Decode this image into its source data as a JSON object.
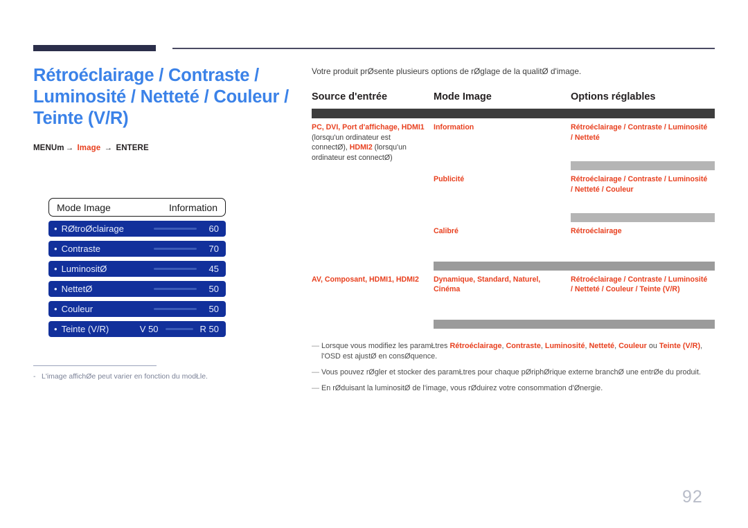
{
  "header": {
    "title": "Rétroéclairage / Contraste / Luminosité / Netteté / Couleur / Teinte (V/R)",
    "menu_path": {
      "menu_label": "MENU",
      "menu_glyph": "m",
      "arrow": "→",
      "middle_label": "Image",
      "enter_label": "ENTER",
      "enter_glyph": "E"
    }
  },
  "osd": {
    "head": {
      "left": "Mode Image",
      "right": "Information"
    },
    "rows": [
      {
        "bullet": "•",
        "label": "RØtroØclairage",
        "value": "60",
        "slider": true
      },
      {
        "bullet": "•",
        "label": "Contraste",
        "value": "70",
        "slider": true
      },
      {
        "bullet": "•",
        "label": "LuminositØ",
        "value": "45",
        "slider": true
      },
      {
        "bullet": "•",
        "label": "NettetØ",
        "value": "50",
        "slider": true
      },
      {
        "bullet": "•",
        "label": "Couleur",
        "value": "50",
        "slider": true
      },
      {
        "bullet": "•",
        "label": "Teinte (V/R)",
        "value": "R 50",
        "value_left": "V 50",
        "slider": true
      }
    ]
  },
  "left_footnote": {
    "dash": "-",
    "text": "L'image affichØe peut varier en fonction du modŁle."
  },
  "right": {
    "intro": "Votre produit prØsente plusieurs options de rØglage de la qualitØ d'image.",
    "table": {
      "headers": [
        "Source d'entrée",
        "Mode Image",
        "Options réglables"
      ],
      "groups": [
        {
          "source_parts": [
            {
              "text": "PC",
              "style": "red"
            },
            {
              "text": ", ",
              "style": "sep"
            },
            {
              "text": "DVI",
              "style": "red"
            },
            {
              "text": ", ",
              "style": "sep"
            },
            {
              "text": "Port d'affichage",
              "style": "red"
            },
            {
              "text": ", ",
              "style": "sep"
            },
            {
              "text": "HDMI1",
              "style": "red"
            },
            {
              "text": " (lorsqu'un ordinateur est connectØ), ",
              "style": "black"
            },
            {
              "text": "HDMI2",
              "style": "red"
            },
            {
              "text": " (lorsqu'un ordinateur est connectØ)",
              "style": "black"
            }
          ],
          "rows": [
            {
              "mode": "Information",
              "options": "Rétroéclairage / Contraste / Luminosité / Netteté"
            },
            {
              "mode": "Publicité",
              "options": "Rétroéclairage / Contraste / Luminosité / Netteté / Couleur"
            },
            {
              "mode": "Calibré",
              "options": "Rétroéclairage"
            }
          ]
        },
        {
          "source_parts": [
            {
              "text": "AV",
              "style": "red"
            },
            {
              "text": ", ",
              "style": "sep"
            },
            {
              "text": "Composant",
              "style": "red"
            },
            {
              "text": ", ",
              "style": "sep"
            },
            {
              "text": "HDMI1",
              "style": "red"
            },
            {
              "text": ", ",
              "style": "sep"
            },
            {
              "text": "HDMI2",
              "style": "red"
            }
          ],
          "rows": [
            {
              "mode": "Dynamique, Standard, Naturel, Cinéma",
              "options": "Rétroéclairage / Contraste / Luminosité / Netteté / Couleur / Teinte (V/R)"
            }
          ]
        }
      ]
    },
    "notes": [
      {
        "dash": "—",
        "parts": [
          {
            "text": "Lorsque vous modifiez les paramŁtres ",
            "style": "plain"
          },
          {
            "text": "Rétroéclairage",
            "style": "red"
          },
          {
            "text": ", ",
            "style": "plain"
          },
          {
            "text": "Contraste",
            "style": "red"
          },
          {
            "text": ", ",
            "style": "plain"
          },
          {
            "text": "Luminosité",
            "style": "red"
          },
          {
            "text": ", ",
            "style": "plain"
          },
          {
            "text": "Netteté",
            "style": "red"
          },
          {
            "text": ", ",
            "style": "plain"
          },
          {
            "text": "Couleur",
            "style": "red"
          },
          {
            "text": " ou ",
            "style": "plain"
          },
          {
            "text": "Teinte (V/R)",
            "style": "red"
          },
          {
            "text": ", l'OSD est ajustØ en consØquence.",
            "style": "plain"
          }
        ]
      },
      {
        "dash": "—",
        "parts": [
          {
            "text": "Vous pouvez rØgler et stocker des paramŁtres pour chaque pØriphØrique externe branchØ  une entrØe du produit.",
            "style": "plain"
          }
        ]
      },
      {
        "dash": "—",
        "parts": [
          {
            "text": "En rØduisant la luminositØ de l'image, vous rØduirez votre consommation d'Ønergie.",
            "style": "plain"
          }
        ]
      }
    ]
  },
  "page_number": "92",
  "colors": {
    "title_blue": "#3b82e8",
    "accent_red": "#e8401f",
    "osd_blue": "#12309b",
    "rule_navy": "#2b2e4a",
    "page_number_gray": "#b9bdc9"
  }
}
